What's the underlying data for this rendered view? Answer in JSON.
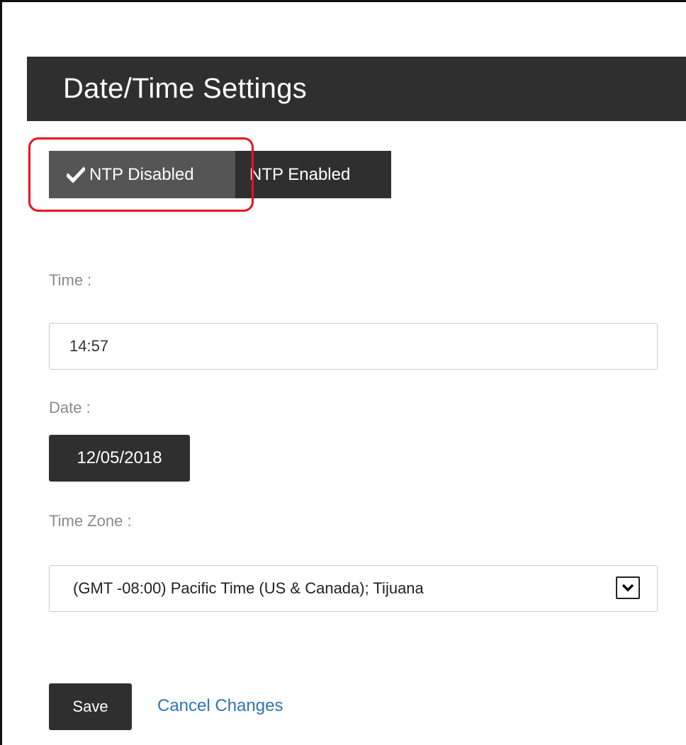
{
  "header": {
    "title": "Date/Time Settings"
  },
  "ntp_toggle": {
    "options": [
      {
        "label": "NTP Disabled",
        "selected": true
      },
      {
        "label": "NTP Enabled",
        "selected": false
      }
    ]
  },
  "time": {
    "label": "Time :",
    "value": "14:57"
  },
  "date": {
    "label": "Date :",
    "value": "12/05/2018"
  },
  "time_zone": {
    "label": "Time Zone :",
    "selected": "(GMT -08:00) Pacific Time (US & Canada); Tijuana"
  },
  "actions": {
    "save_label": "Save",
    "cancel_label": "Cancel Changes"
  },
  "colors": {
    "header_bg": "#2f2f2f",
    "active_toggle_bg": "#555555",
    "highlight_border": "#e8121e",
    "link": "#2e74b5"
  }
}
